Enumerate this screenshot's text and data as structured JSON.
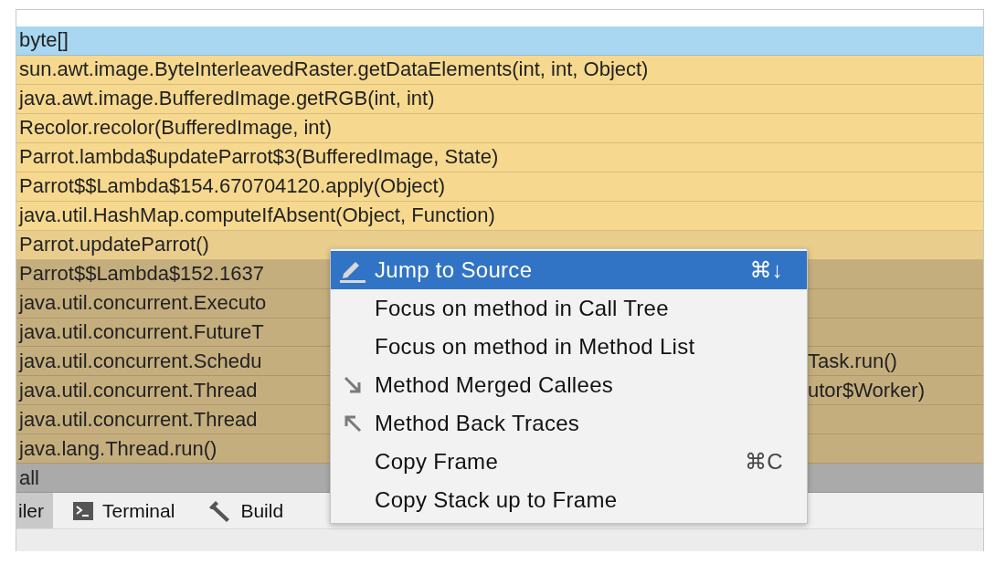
{
  "frames": [
    {
      "text": "byte[]",
      "color": "#a9d7f1"
    },
    {
      "text": "sun.awt.image.ByteInterleavedRaster.getDataElements(int, int, Object)",
      "color": "#f6d98f"
    },
    {
      "text": "java.awt.image.BufferedImage.getRGB(int, int)",
      "color": "#f6d98f"
    },
    {
      "text": "Recolor.recolor(BufferedImage, int)",
      "color": "#f6d98f"
    },
    {
      "text": "Parrot.lambda$updateParrot$3(BufferedImage, State)",
      "color": "#f6d98f"
    },
    {
      "text": "Parrot$$Lambda$154.670704120.apply(Object)",
      "color": "#f6d98f"
    },
    {
      "text": "java.util.HashMap.computeIfAbsent(Object, Function)",
      "color": "#f6d98f"
    },
    {
      "text": "Parrot.updateParrot()",
      "color": "#e9cd8c"
    },
    {
      "text": "Parrot$$Lambda$152.1637",
      "color": "#c5ae7e"
    },
    {
      "text": "java.util.concurrent.Executo",
      "color": "#c5ae7e"
    },
    {
      "text": "java.util.concurrent.FutureT",
      "color": "#c5ae7e"
    },
    {
      "text": "java.util.concurrent.Schedu",
      "tail": "Task.run()",
      "color": "#c5ae7e"
    },
    {
      "text": "java.util.concurrent.Thread",
      "tail": "utor$Worker)",
      "color": "#c5ae7e"
    },
    {
      "text": "java.util.concurrent.Thread",
      "color": "#c5ae7e"
    },
    {
      "text": "java.lang.Thread.run()",
      "color": "#c5ae7e"
    },
    {
      "text": "all",
      "color": "#aaaaaa"
    }
  ],
  "tool_tabs": [
    {
      "label": "iler",
      "kind": "plain",
      "selected": true
    },
    {
      "label": "Terminal",
      "kind": "terminal",
      "selected": false
    },
    {
      "label": "Build",
      "kind": "build",
      "selected": false
    }
  ],
  "context_menu": [
    {
      "label": "Jump to Source",
      "kind": "jump",
      "shortcut": "⌘↓",
      "selected": true
    },
    {
      "label": "Focus on method in Call Tree",
      "kind": "plain",
      "selected": false
    },
    {
      "label": "Focus on method in Method List",
      "kind": "plain",
      "selected": false
    },
    {
      "label": "Method Merged Callees",
      "kind": "callees",
      "selected": false
    },
    {
      "label": "Method Back Traces",
      "kind": "traces",
      "selected": false
    },
    {
      "label": "Copy Frame",
      "kind": "plain",
      "shortcut": "⌘C",
      "selected": false
    },
    {
      "label": "Copy Stack up to Frame",
      "kind": "plain",
      "selected": false
    }
  ]
}
